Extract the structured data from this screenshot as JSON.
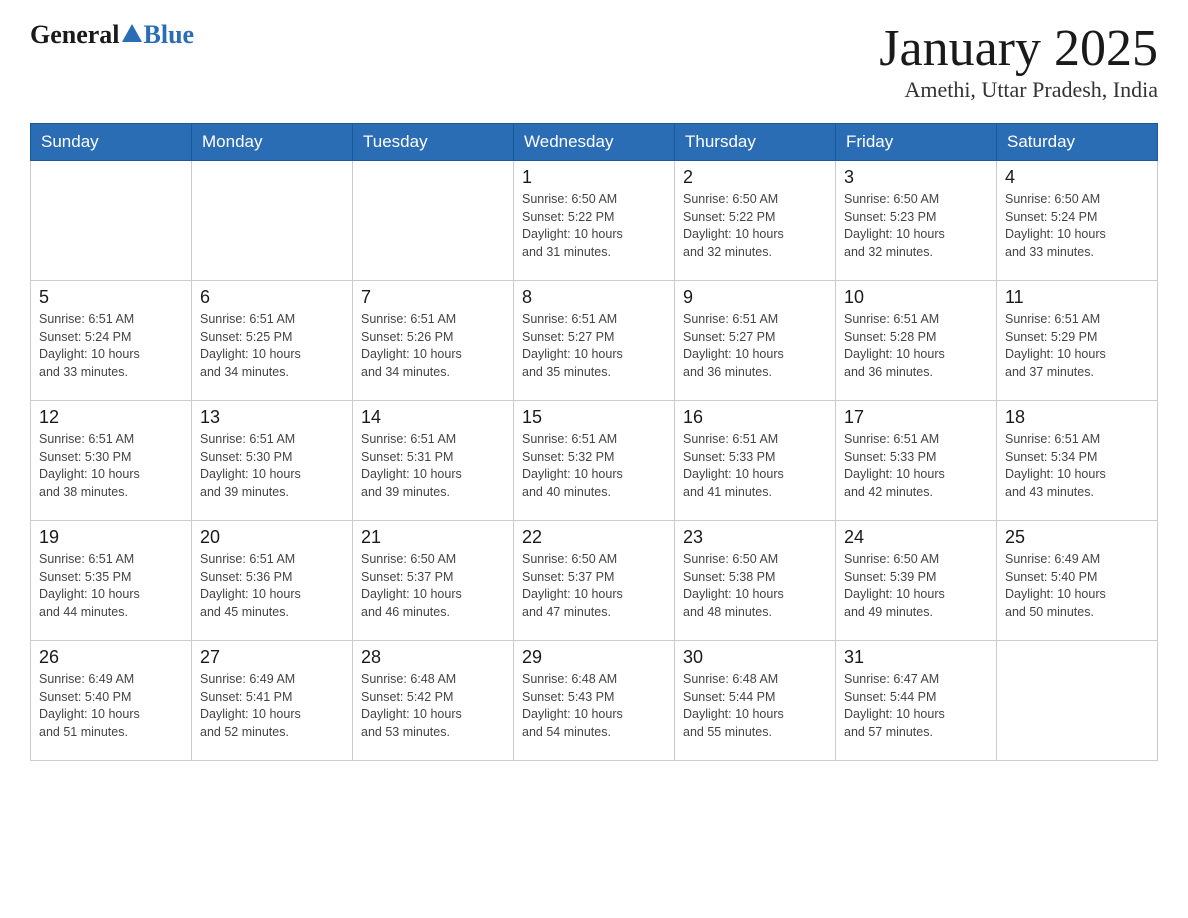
{
  "header": {
    "logo_general": "General",
    "logo_blue": "Blue",
    "month_title": "January 2025",
    "subtitle": "Amethi, Uttar Pradesh, India"
  },
  "weekdays": [
    "Sunday",
    "Monday",
    "Tuesday",
    "Wednesday",
    "Thursday",
    "Friday",
    "Saturday"
  ],
  "weeks": [
    [
      {
        "day": "",
        "info": ""
      },
      {
        "day": "",
        "info": ""
      },
      {
        "day": "",
        "info": ""
      },
      {
        "day": "1",
        "info": "Sunrise: 6:50 AM\nSunset: 5:22 PM\nDaylight: 10 hours\nand 31 minutes."
      },
      {
        "day": "2",
        "info": "Sunrise: 6:50 AM\nSunset: 5:22 PM\nDaylight: 10 hours\nand 32 minutes."
      },
      {
        "day": "3",
        "info": "Sunrise: 6:50 AM\nSunset: 5:23 PM\nDaylight: 10 hours\nand 32 minutes."
      },
      {
        "day": "4",
        "info": "Sunrise: 6:50 AM\nSunset: 5:24 PM\nDaylight: 10 hours\nand 33 minutes."
      }
    ],
    [
      {
        "day": "5",
        "info": "Sunrise: 6:51 AM\nSunset: 5:24 PM\nDaylight: 10 hours\nand 33 minutes."
      },
      {
        "day": "6",
        "info": "Sunrise: 6:51 AM\nSunset: 5:25 PM\nDaylight: 10 hours\nand 34 minutes."
      },
      {
        "day": "7",
        "info": "Sunrise: 6:51 AM\nSunset: 5:26 PM\nDaylight: 10 hours\nand 34 minutes."
      },
      {
        "day": "8",
        "info": "Sunrise: 6:51 AM\nSunset: 5:27 PM\nDaylight: 10 hours\nand 35 minutes."
      },
      {
        "day": "9",
        "info": "Sunrise: 6:51 AM\nSunset: 5:27 PM\nDaylight: 10 hours\nand 36 minutes."
      },
      {
        "day": "10",
        "info": "Sunrise: 6:51 AM\nSunset: 5:28 PM\nDaylight: 10 hours\nand 36 minutes."
      },
      {
        "day": "11",
        "info": "Sunrise: 6:51 AM\nSunset: 5:29 PM\nDaylight: 10 hours\nand 37 minutes."
      }
    ],
    [
      {
        "day": "12",
        "info": "Sunrise: 6:51 AM\nSunset: 5:30 PM\nDaylight: 10 hours\nand 38 minutes."
      },
      {
        "day": "13",
        "info": "Sunrise: 6:51 AM\nSunset: 5:30 PM\nDaylight: 10 hours\nand 39 minutes."
      },
      {
        "day": "14",
        "info": "Sunrise: 6:51 AM\nSunset: 5:31 PM\nDaylight: 10 hours\nand 39 minutes."
      },
      {
        "day": "15",
        "info": "Sunrise: 6:51 AM\nSunset: 5:32 PM\nDaylight: 10 hours\nand 40 minutes."
      },
      {
        "day": "16",
        "info": "Sunrise: 6:51 AM\nSunset: 5:33 PM\nDaylight: 10 hours\nand 41 minutes."
      },
      {
        "day": "17",
        "info": "Sunrise: 6:51 AM\nSunset: 5:33 PM\nDaylight: 10 hours\nand 42 minutes."
      },
      {
        "day": "18",
        "info": "Sunrise: 6:51 AM\nSunset: 5:34 PM\nDaylight: 10 hours\nand 43 minutes."
      }
    ],
    [
      {
        "day": "19",
        "info": "Sunrise: 6:51 AM\nSunset: 5:35 PM\nDaylight: 10 hours\nand 44 minutes."
      },
      {
        "day": "20",
        "info": "Sunrise: 6:51 AM\nSunset: 5:36 PM\nDaylight: 10 hours\nand 45 minutes."
      },
      {
        "day": "21",
        "info": "Sunrise: 6:50 AM\nSunset: 5:37 PM\nDaylight: 10 hours\nand 46 minutes."
      },
      {
        "day": "22",
        "info": "Sunrise: 6:50 AM\nSunset: 5:37 PM\nDaylight: 10 hours\nand 47 minutes."
      },
      {
        "day": "23",
        "info": "Sunrise: 6:50 AM\nSunset: 5:38 PM\nDaylight: 10 hours\nand 48 minutes."
      },
      {
        "day": "24",
        "info": "Sunrise: 6:50 AM\nSunset: 5:39 PM\nDaylight: 10 hours\nand 49 minutes."
      },
      {
        "day": "25",
        "info": "Sunrise: 6:49 AM\nSunset: 5:40 PM\nDaylight: 10 hours\nand 50 minutes."
      }
    ],
    [
      {
        "day": "26",
        "info": "Sunrise: 6:49 AM\nSunset: 5:40 PM\nDaylight: 10 hours\nand 51 minutes."
      },
      {
        "day": "27",
        "info": "Sunrise: 6:49 AM\nSunset: 5:41 PM\nDaylight: 10 hours\nand 52 minutes."
      },
      {
        "day": "28",
        "info": "Sunrise: 6:48 AM\nSunset: 5:42 PM\nDaylight: 10 hours\nand 53 minutes."
      },
      {
        "day": "29",
        "info": "Sunrise: 6:48 AM\nSunset: 5:43 PM\nDaylight: 10 hours\nand 54 minutes."
      },
      {
        "day": "30",
        "info": "Sunrise: 6:48 AM\nSunset: 5:44 PM\nDaylight: 10 hours\nand 55 minutes."
      },
      {
        "day": "31",
        "info": "Sunrise: 6:47 AM\nSunset: 5:44 PM\nDaylight: 10 hours\nand 57 minutes."
      },
      {
        "day": "",
        "info": ""
      }
    ]
  ]
}
